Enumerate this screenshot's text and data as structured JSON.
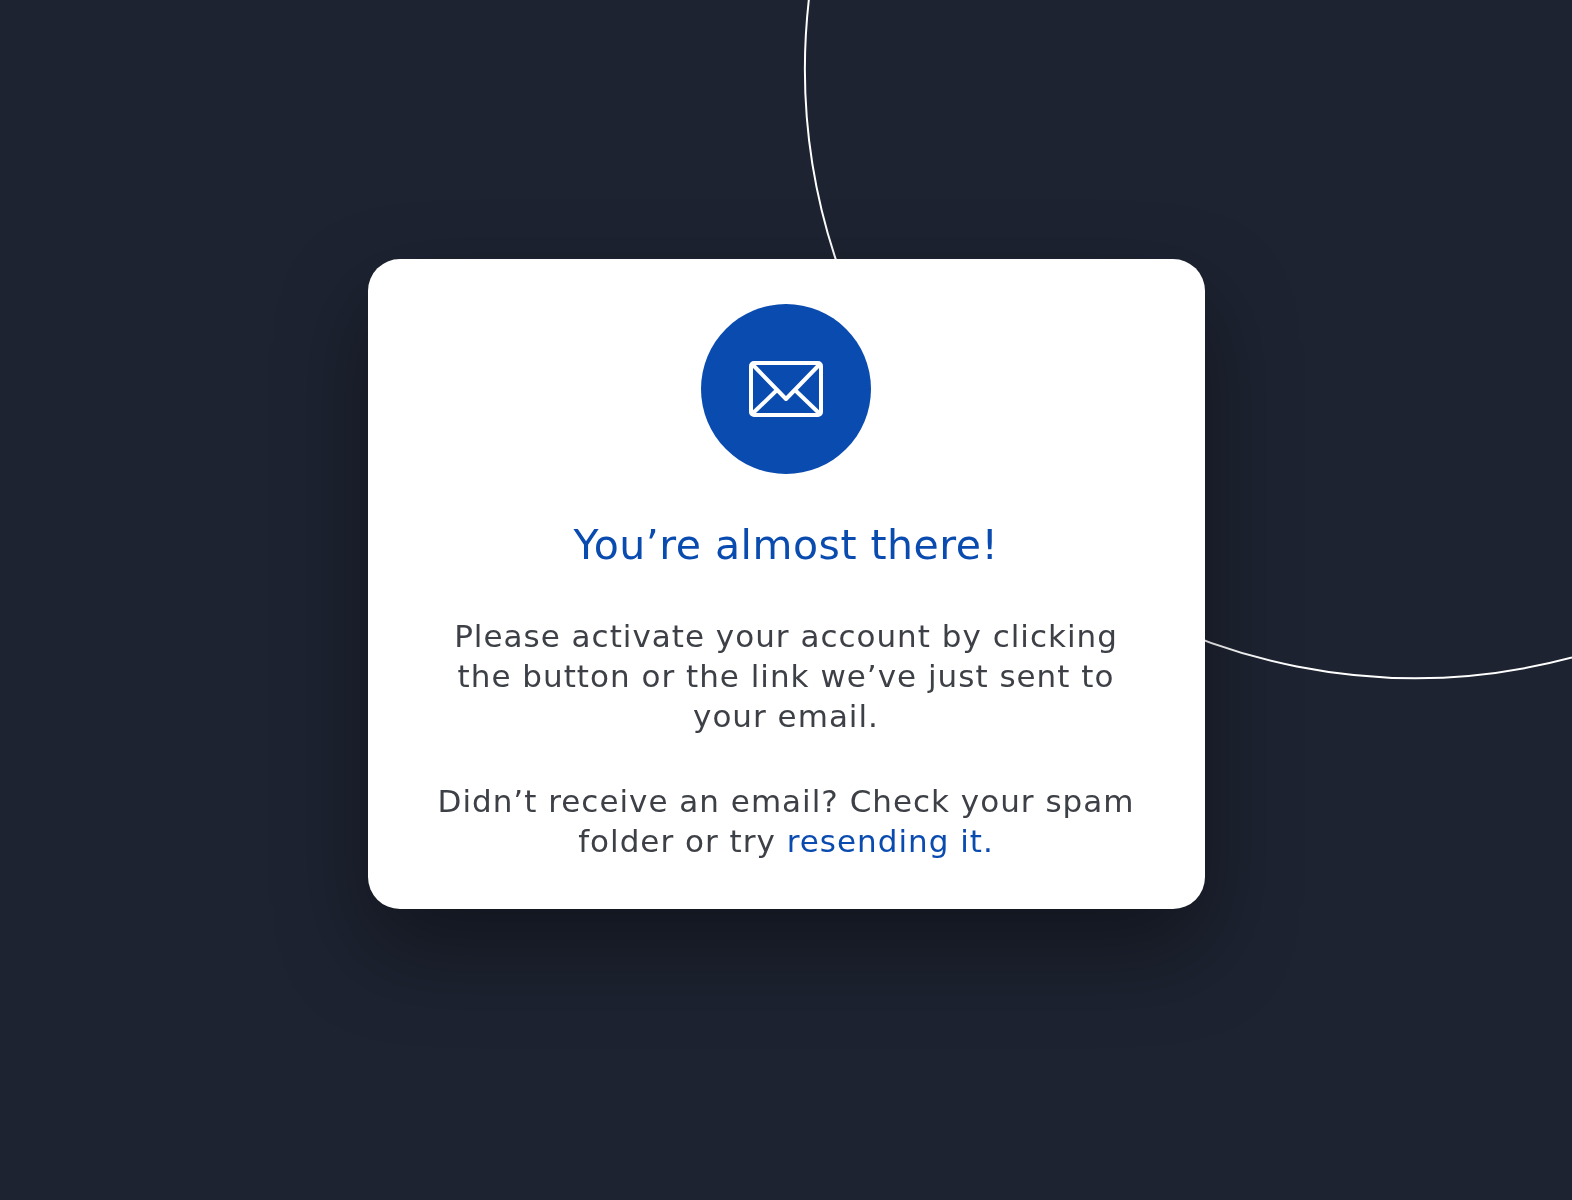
{
  "dialog": {
    "title": "You’re almost there!",
    "message": "Please activate your account by clicking the button or the link we’ve just sent to your email.",
    "resend_prompt": "Didn’t receive an email? Check your spam folder or try",
    "resend_link": "resending it."
  }
}
